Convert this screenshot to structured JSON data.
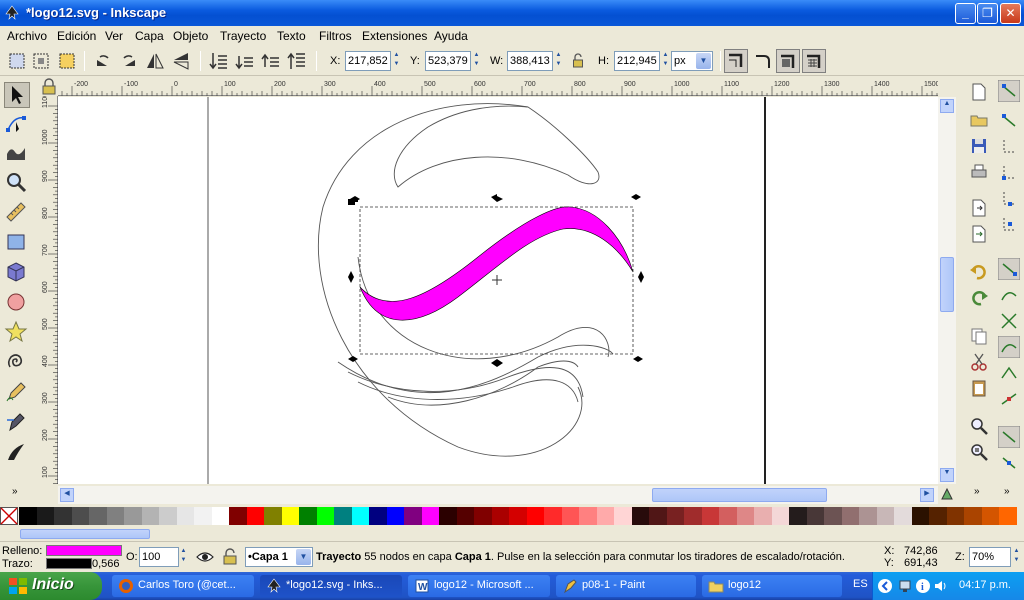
{
  "window": {
    "title": "*logo12.svg - Inkscape"
  },
  "menu": [
    "Archivo",
    "Edición",
    "Ver",
    "Capa",
    "Objeto",
    "Trayecto",
    "Texto",
    "Filtros",
    "Extensiones",
    "Ayuda"
  ],
  "toolbar": {
    "x_label": "X:",
    "x_value": "217,852",
    "y_label": "Y:",
    "y_value": "523,379",
    "w_label": "W:",
    "w_value": "388,413",
    "h_label": "H:",
    "h_value": "212,945",
    "unit": "px"
  },
  "rulers": {
    "h_labels": [
      "-200",
      "-100",
      "0",
      "100",
      "200",
      "300",
      "400",
      "500",
      "600",
      "700",
      "800",
      "900",
      "1000",
      "1100",
      "1200",
      "1300",
      "1400",
      "1500"
    ],
    "v_labels": [
      "1100",
      "1000",
      "900",
      "800",
      "700",
      "600",
      "500",
      "400",
      "300",
      "200",
      "100"
    ]
  },
  "selection": {
    "fill_color": "#ff00ff"
  },
  "status": {
    "fill_label": "Relleno:",
    "stroke_label": "Trazo:",
    "fill_color": "#ff00ff",
    "stroke_color": "#000000",
    "stroke_width": "0,566",
    "opacity_label": "O:",
    "opacity_value": "100",
    "layer": "•Capa 1",
    "message_bold1": "Trayecto",
    "message_part1": " 55 nodos en capa ",
    "message_bold2": "Capa 1",
    "message_part2": ". Pulse en la selección para conmutar los tiradores de escalado/rotación.",
    "cursor_x_label": "X:",
    "cursor_x": "742,86",
    "cursor_y_label": "Y:",
    "cursor_y": "691,43",
    "zoom_label": "Z:",
    "zoom_value": "70%"
  },
  "palette": [
    "#000000",
    "#1a1a1a",
    "#333333",
    "#4d4d4d",
    "#666666",
    "#808080",
    "#999999",
    "#b3b3b3",
    "#cccccc",
    "#e6e6e6",
    "#f2f2f2",
    "#ffffff",
    "#800000",
    "#ff0000",
    "#808000",
    "#ffff00",
    "#008000",
    "#00ff00",
    "#008080",
    "#00ffff",
    "#000080",
    "#0000ff",
    "#800080",
    "#ff00ff",
    "#2b0000",
    "#550000",
    "#800000",
    "#aa0000",
    "#d40000",
    "#ff0000",
    "#ff2a2a",
    "#ff5555",
    "#ff8080",
    "#ffaaaa",
    "#ffd5d5",
    "#280b0b",
    "#501616",
    "#782121",
    "#a02c2c",
    "#c83737",
    "#d35f5f",
    "#de8787",
    "#e9afaf",
    "#f4d7d7",
    "#241c1c",
    "#483737",
    "#6c5353",
    "#916f6f",
    "#ac9393",
    "#c8b7b7",
    "#e3dbdb",
    "#2b1100",
    "#552200",
    "#803300",
    "#aa4400",
    "#d45500",
    "#ff6600"
  ],
  "taskbar": {
    "start": "Inicio",
    "tasks": [
      "Carlos Toro (@cet...",
      "*logo12.svg - Inks...",
      "logo12 - Microsoft ...",
      "p08-1 - Paint",
      "logo12"
    ],
    "language": "ES",
    "clock": "04:17 p.m."
  }
}
